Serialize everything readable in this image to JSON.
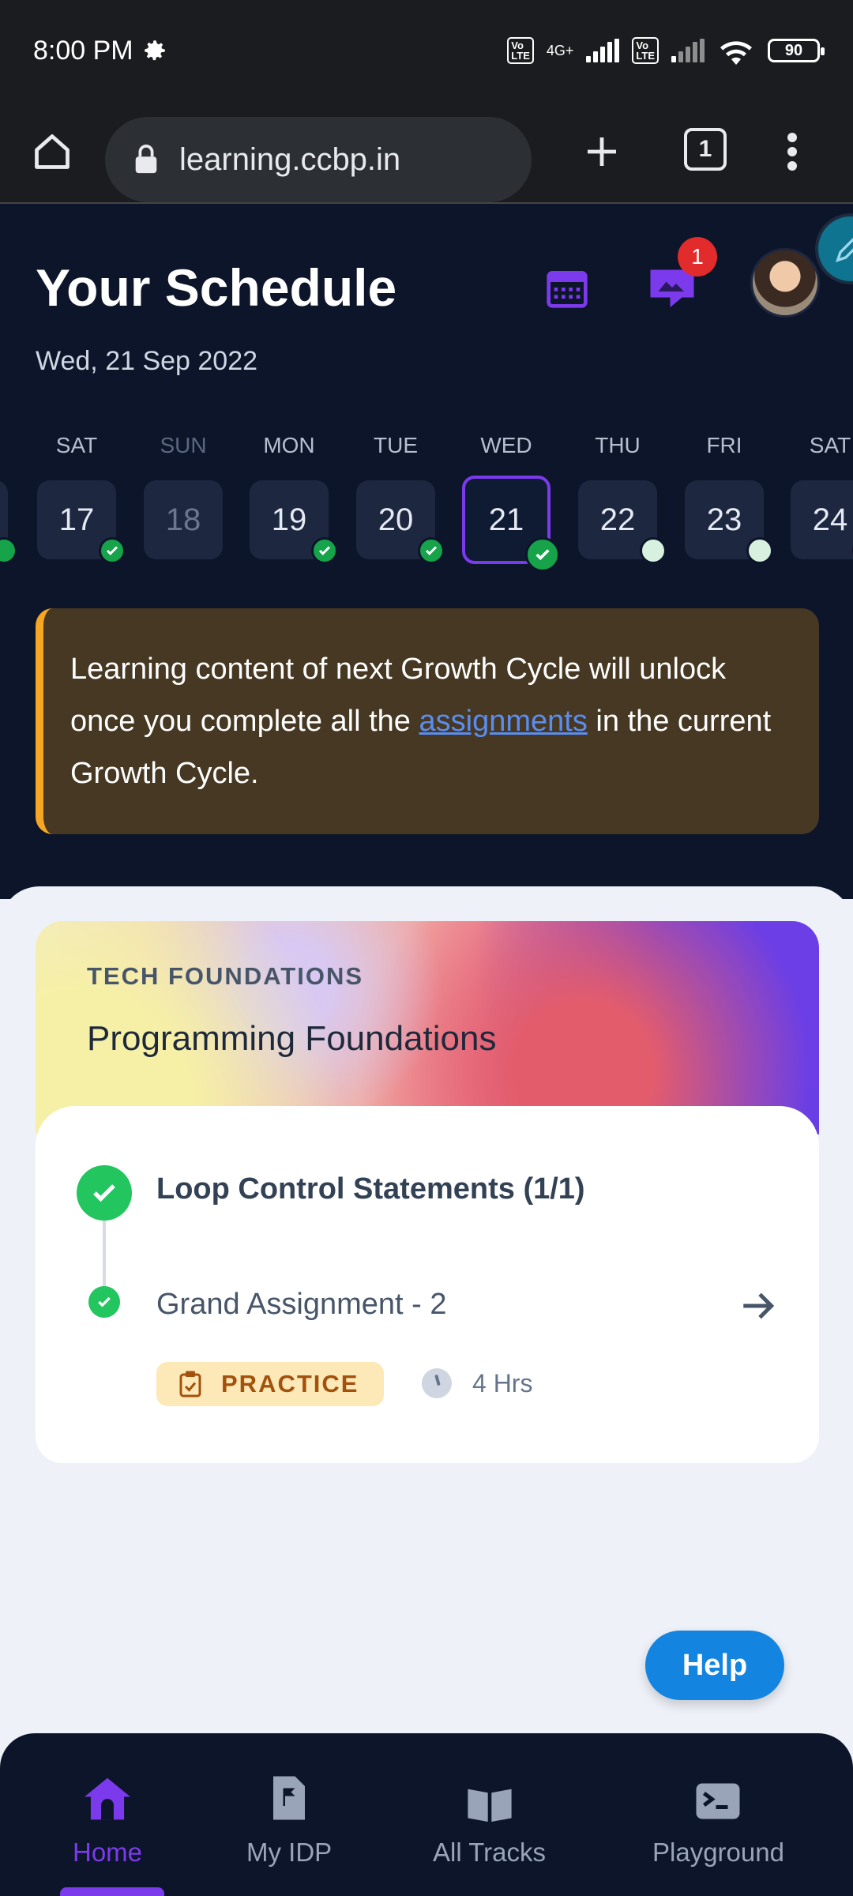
{
  "status_bar": {
    "time": "8:00 PM",
    "network": "4G+",
    "battery": "90"
  },
  "browser": {
    "url": "learning.ccbp.in",
    "tab_count": "1"
  },
  "header": {
    "title": "Your Schedule",
    "date": "Wed, 21 Sep 2022",
    "notification_count": "1"
  },
  "days": [
    {
      "name": "SAT",
      "num": "17",
      "status": "done"
    },
    {
      "name": "SUN",
      "num": "18",
      "status": "off"
    },
    {
      "name": "MON",
      "num": "19",
      "status": "done"
    },
    {
      "name": "TUE",
      "num": "20",
      "status": "done"
    },
    {
      "name": "WED",
      "num": "21",
      "status": "done",
      "active": true
    },
    {
      "name": "THU",
      "num": "22",
      "status": "pending"
    },
    {
      "name": "FRI",
      "num": "23",
      "status": "pending"
    },
    {
      "name": "SAT",
      "num": "24",
      "status": "pending"
    }
  ],
  "notice": {
    "text_before": "Learning content of next Growth Cycle will unlock once you complete all the",
    "link": "assignments",
    "text_after": " in the current Growth Cycle."
  },
  "course": {
    "track": "TECH FOUNDATIONS",
    "title": "Programming Foundations",
    "section_title": "Loop Control Statements (1/1)",
    "item_title": "Grand Assignment - 2",
    "tag": "PRACTICE",
    "duration": "4 Hrs"
  },
  "help_label": "Help",
  "nav": {
    "home": "Home",
    "idp": "My IDP",
    "tracks": "All Tracks",
    "playground": "Playground"
  },
  "colors": {
    "accent": "#7c3aed",
    "success": "#22c55e",
    "warning": "#f5a623",
    "help": "#1384e0"
  }
}
